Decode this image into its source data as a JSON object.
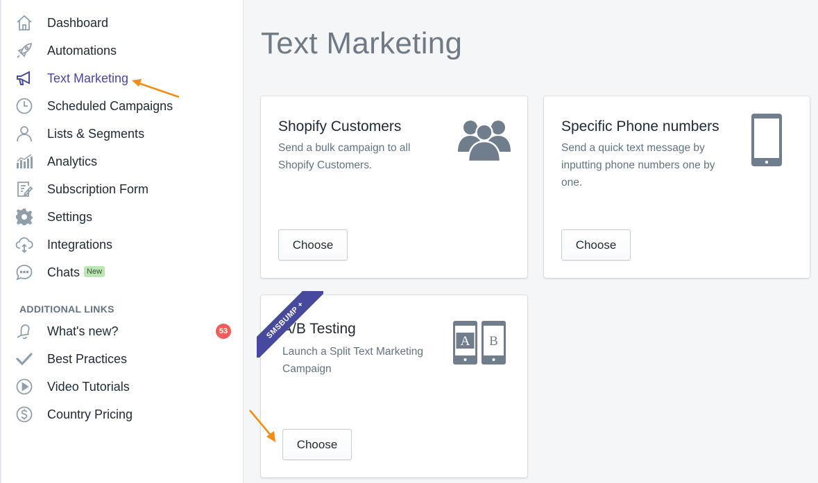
{
  "sidebar": {
    "items": [
      {
        "label": "Dashboard",
        "icon": "home-icon"
      },
      {
        "label": "Automations",
        "icon": "rocket-icon"
      },
      {
        "label": "Text Marketing",
        "icon": "megaphone-icon",
        "active": true
      },
      {
        "label": "Scheduled Campaigns",
        "icon": "clock-icon"
      },
      {
        "label": "Lists & Segments",
        "icon": "user-icon"
      },
      {
        "label": "Analytics",
        "icon": "bar-chart-icon"
      },
      {
        "label": "Subscription Form",
        "icon": "form-icon"
      },
      {
        "label": "Settings",
        "icon": "gear-icon"
      },
      {
        "label": "Integrations",
        "icon": "cloud-sync-icon"
      },
      {
        "label": "Chats",
        "icon": "chat-bubble-icon",
        "badge": "New"
      }
    ],
    "additional_heading": "ADDITIONAL LINKS",
    "additional_items": [
      {
        "label": "What's new?",
        "icon": "bell-icon",
        "count": "53"
      },
      {
        "label": "Best Practices",
        "icon": "checkmark-icon"
      },
      {
        "label": "Video Tutorials",
        "icon": "play-circle-icon"
      },
      {
        "label": "Country Pricing",
        "icon": "dollar-circle-icon"
      }
    ]
  },
  "main": {
    "title": "Text Marketing",
    "cards": [
      {
        "title": "Shopify Customers",
        "description": "Send a bulk campaign to all Shopify Customers.",
        "button": "Choose",
        "illustration": "group-of-people-icon"
      },
      {
        "title": "Specific Phone numbers",
        "description": "Send a quick text message by inputting phone numbers one by one.",
        "button": "Choose",
        "illustration": "mobile-phone-icon"
      },
      {
        "title": "A/B Testing",
        "description": "Launch a Split Text Marketing Campaign",
        "button": "Choose",
        "illustration": "ab-phones-icon",
        "ribbon": "SMSBUMP +",
        "phone_a": "A",
        "phone_b": "B"
      }
    ]
  },
  "colors": {
    "accent": "#47499e",
    "arrow": "#f28c13",
    "icon_gray": "#919eab",
    "illustration_gray": "#6f7d8c",
    "badge_red": "#f45b5b",
    "new_badge": "#bbe5b3"
  }
}
